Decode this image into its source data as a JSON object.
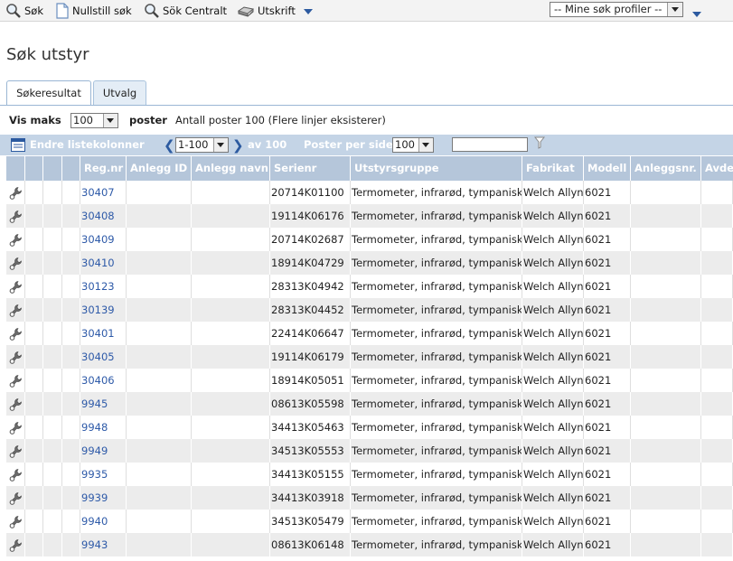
{
  "toolbar": {
    "search_label": "Søk",
    "reset_label": "Nullstill søk",
    "central_label": "Sök Centralt",
    "print_label": "Utskrift",
    "profile_select": "-- Mine søk profiler --"
  },
  "page": {
    "title": "Søk utstyr"
  },
  "tabs": [
    {
      "label": "Søkeresultat",
      "active": true
    },
    {
      "label": "Utvalg",
      "active": false
    }
  ],
  "filter": {
    "vis_maks_label": "Vis maks",
    "vis_maks_value": "100",
    "poster_label": "poster",
    "antall_text": "Antall poster 100 (Flere linjer eksisterer)"
  },
  "listbar": {
    "edit_columns_label": "Endre listekolonner",
    "range_value": "1-100",
    "of_text": "av 100",
    "per_page_label": "Poster per side",
    "per_page_value": "100",
    "quick_filter_value": ""
  },
  "columns": [
    "",
    "",
    "",
    "Reg.nr",
    "Anlegg ID",
    "Anlegg navn",
    "Serienr",
    "Utstyrsgruppe",
    "Fabrikat",
    "Modell",
    "Anleggsnr.",
    "Avde"
  ],
  "rows": [
    {
      "regnr": "30407",
      "anlegg_id": "",
      "anlegg_navn": "",
      "serienr": "20714K01100",
      "gruppe": "Termometer, infrarød, tympanisk",
      "fabrikat": "Welch Allyn",
      "modell": "6021",
      "anleggsnr": "",
      "avd": ""
    },
    {
      "regnr": "30408",
      "anlegg_id": "",
      "anlegg_navn": "",
      "serienr": "19114K06176",
      "gruppe": "Termometer, infrarød, tympanisk",
      "fabrikat": "Welch Allyn",
      "modell": "6021",
      "anleggsnr": "",
      "avd": ""
    },
    {
      "regnr": "30409",
      "anlegg_id": "",
      "anlegg_navn": "",
      "serienr": "20714K02687",
      "gruppe": "Termometer, infrarød, tympanisk",
      "fabrikat": "Welch Allyn",
      "modell": "6021",
      "anleggsnr": "",
      "avd": ""
    },
    {
      "regnr": "30410",
      "anlegg_id": "",
      "anlegg_navn": "",
      "serienr": "18914K04729",
      "gruppe": "Termometer, infrarød, tympanisk",
      "fabrikat": "Welch Allyn",
      "modell": "6021",
      "anleggsnr": "",
      "avd": ""
    },
    {
      "regnr": "30123",
      "anlegg_id": "",
      "anlegg_navn": "",
      "serienr": "28313K04942",
      "gruppe": "Termometer, infrarød, tympanisk",
      "fabrikat": "Welch Allyn",
      "modell": "6021",
      "anleggsnr": "",
      "avd": ""
    },
    {
      "regnr": "30139",
      "anlegg_id": "",
      "anlegg_navn": "",
      "serienr": "28313K04452",
      "gruppe": "Termometer, infrarød, tympanisk",
      "fabrikat": "Welch Allyn",
      "modell": "6021",
      "anleggsnr": "",
      "avd": ""
    },
    {
      "regnr": "30401",
      "anlegg_id": "",
      "anlegg_navn": "",
      "serienr": "22414K06647",
      "gruppe": "Termometer, infrarød, tympanisk",
      "fabrikat": "Welch Allyn",
      "modell": "6021",
      "anleggsnr": "",
      "avd": ""
    },
    {
      "regnr": "30405",
      "anlegg_id": "",
      "anlegg_navn": "",
      "serienr": "19114K06179",
      "gruppe": "Termometer, infrarød, tympanisk",
      "fabrikat": "Welch Allyn",
      "modell": "6021",
      "anleggsnr": "",
      "avd": ""
    },
    {
      "regnr": "30406",
      "anlegg_id": "",
      "anlegg_navn": "",
      "serienr": "18914K05051",
      "gruppe": "Termometer, infrarød, tympanisk",
      "fabrikat": "Welch Allyn",
      "modell": "6021",
      "anleggsnr": "",
      "avd": ""
    },
    {
      "regnr": "9945",
      "anlegg_id": "",
      "anlegg_navn": "",
      "serienr": "08613K05598",
      "gruppe": "Termometer, infrarød, tympanisk",
      "fabrikat": "Welch Allyn",
      "modell": "6021",
      "anleggsnr": "",
      "avd": ""
    },
    {
      "regnr": "9948",
      "anlegg_id": "",
      "anlegg_navn": "",
      "serienr": "34413K05463",
      "gruppe": "Termometer, infrarød, tympanisk",
      "fabrikat": "Welch Allyn",
      "modell": "6021",
      "anleggsnr": "",
      "avd": ""
    },
    {
      "regnr": "9949",
      "anlegg_id": "",
      "anlegg_navn": "",
      "serienr": "34513K05553",
      "gruppe": "Termometer, infrarød, tympanisk",
      "fabrikat": "Welch Allyn",
      "modell": "6021",
      "anleggsnr": "",
      "avd": ""
    },
    {
      "regnr": "9935",
      "anlegg_id": "",
      "anlegg_navn": "",
      "serienr": "34413K05155",
      "gruppe": "Termometer, infrarød, tympanisk",
      "fabrikat": "Welch Allyn",
      "modell": "6021",
      "anleggsnr": "",
      "avd": ""
    },
    {
      "regnr": "9939",
      "anlegg_id": "",
      "anlegg_navn": "",
      "serienr": "34413K03918",
      "gruppe": "Termometer, infrarød, tympanisk",
      "fabrikat": "Welch Allyn",
      "modell": "6021",
      "anleggsnr": "",
      "avd": ""
    },
    {
      "regnr": "9940",
      "anlegg_id": "",
      "anlegg_navn": "",
      "serienr": "34513K05479",
      "gruppe": "Termometer, infrarød, tympanisk",
      "fabrikat": "Welch Allyn",
      "modell": "6021",
      "anleggsnr": "",
      "avd": ""
    },
    {
      "regnr": "9943",
      "anlegg_id": "",
      "anlegg_navn": "",
      "serienr": "08613K06148",
      "gruppe": "Termometer, infrarød, tympanisk",
      "fabrikat": "Welch Allyn",
      "modell": "6021",
      "anleggsnr": "",
      "avd": ""
    }
  ],
  "icons": {
    "search": "magnifier-icon",
    "reset": "document-icon",
    "central": "magnifier-icon",
    "print": "printer-icon",
    "row_action": "wrench-icon"
  },
  "colors": {
    "link": "#2e5aa8",
    "header_bg": "#b5c6da",
    "listbar_bg": "#c4d4e6",
    "accent": "#2c5aa0"
  }
}
